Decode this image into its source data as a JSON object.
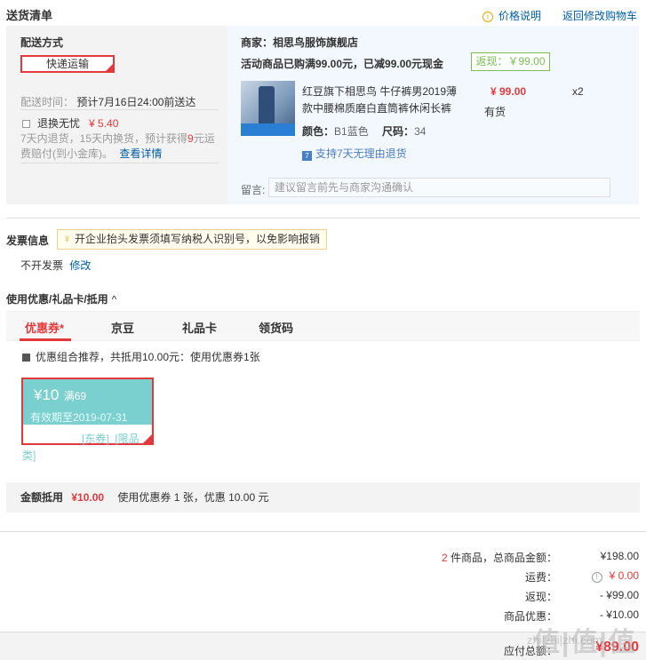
{
  "delivery_list": {
    "title": "送货清单",
    "price_explain": "价格说明",
    "back_to_cart": "返回修改购物车"
  },
  "shipping": {
    "label": "配送方式",
    "method": "快递运输",
    "time_label": "配送时间：",
    "time_value": "预计7月16日24:00前送达",
    "insurance_label": "退换无忧",
    "insurance_price": "¥ 5.40",
    "desc_line1_pre": "7天内退货，15天内换货，预计获得",
    "desc_line1_num": "9",
    "desc_line1_post": "元运",
    "desc_line2": "费赔付(到小金库)。",
    "details_link": "查看详情"
  },
  "shop": {
    "label": "商家：相思鸟服饰旗舰店",
    "promo": "活动商品已购满99.00元，已减99.00元现金",
    "cashback": "返现：￥99.00",
    "product_name_line1": "红豆旗下相思鸟 牛仔裤男2019薄",
    "product_name_line2": "款中腰棉质磨白直筒裤休闲长裤",
    "price": "¥ 99.00",
    "qty": "x2",
    "stock": "有货",
    "color_label": "颜色：",
    "color_value": "B1蓝色",
    "size_label": "尺码：",
    "size_value": "34",
    "return_policy": "支持7天无理由退货",
    "message_label": "留言:",
    "message_placeholder": "建议留言前先与商家沟通确认"
  },
  "invoice": {
    "title": "发票信息",
    "tip": "开企业抬头发票须填写纳税人识别号，以免影响报销",
    "value": "不开发票",
    "edit": "修改"
  },
  "coupons": {
    "title": "使用优惠/礼品卡/抵用",
    "tabs": [
      "优惠券*",
      "京豆",
      "礼品卡",
      "领货码"
    ],
    "combo_text": "优惠组合推荐，共抵用10.00元：使用优惠券1张",
    "coupon_amount": "¥10",
    "coupon_condition": "满69",
    "coupon_expiry": "有效期至2019-07-31",
    "coupon_tags_line1": "[东券]  [限品",
    "coupon_tags_line2": "类]",
    "deduct_label": "金额抵用",
    "deduct_value": "¥10.00",
    "deduct_desc": "使用优惠券 1 张，优惠 10.00 元"
  },
  "summary": {
    "count": "2",
    "count_label": "件商品，总商品金额：",
    "total": "¥198.00",
    "shipping_label": "运费：",
    "shipping_value": "¥ 0.00",
    "cashback_label": "返现：",
    "cashback_value": "- ¥99.00",
    "discount_label": "商品优惠：",
    "discount_value": "- ¥10.00",
    "pay_label": "应付总额：",
    "pay_value": "¥89.00"
  },
  "watermark": "值|值|值",
  "watermark_url": "zhi|zhi|zhi.com"
}
